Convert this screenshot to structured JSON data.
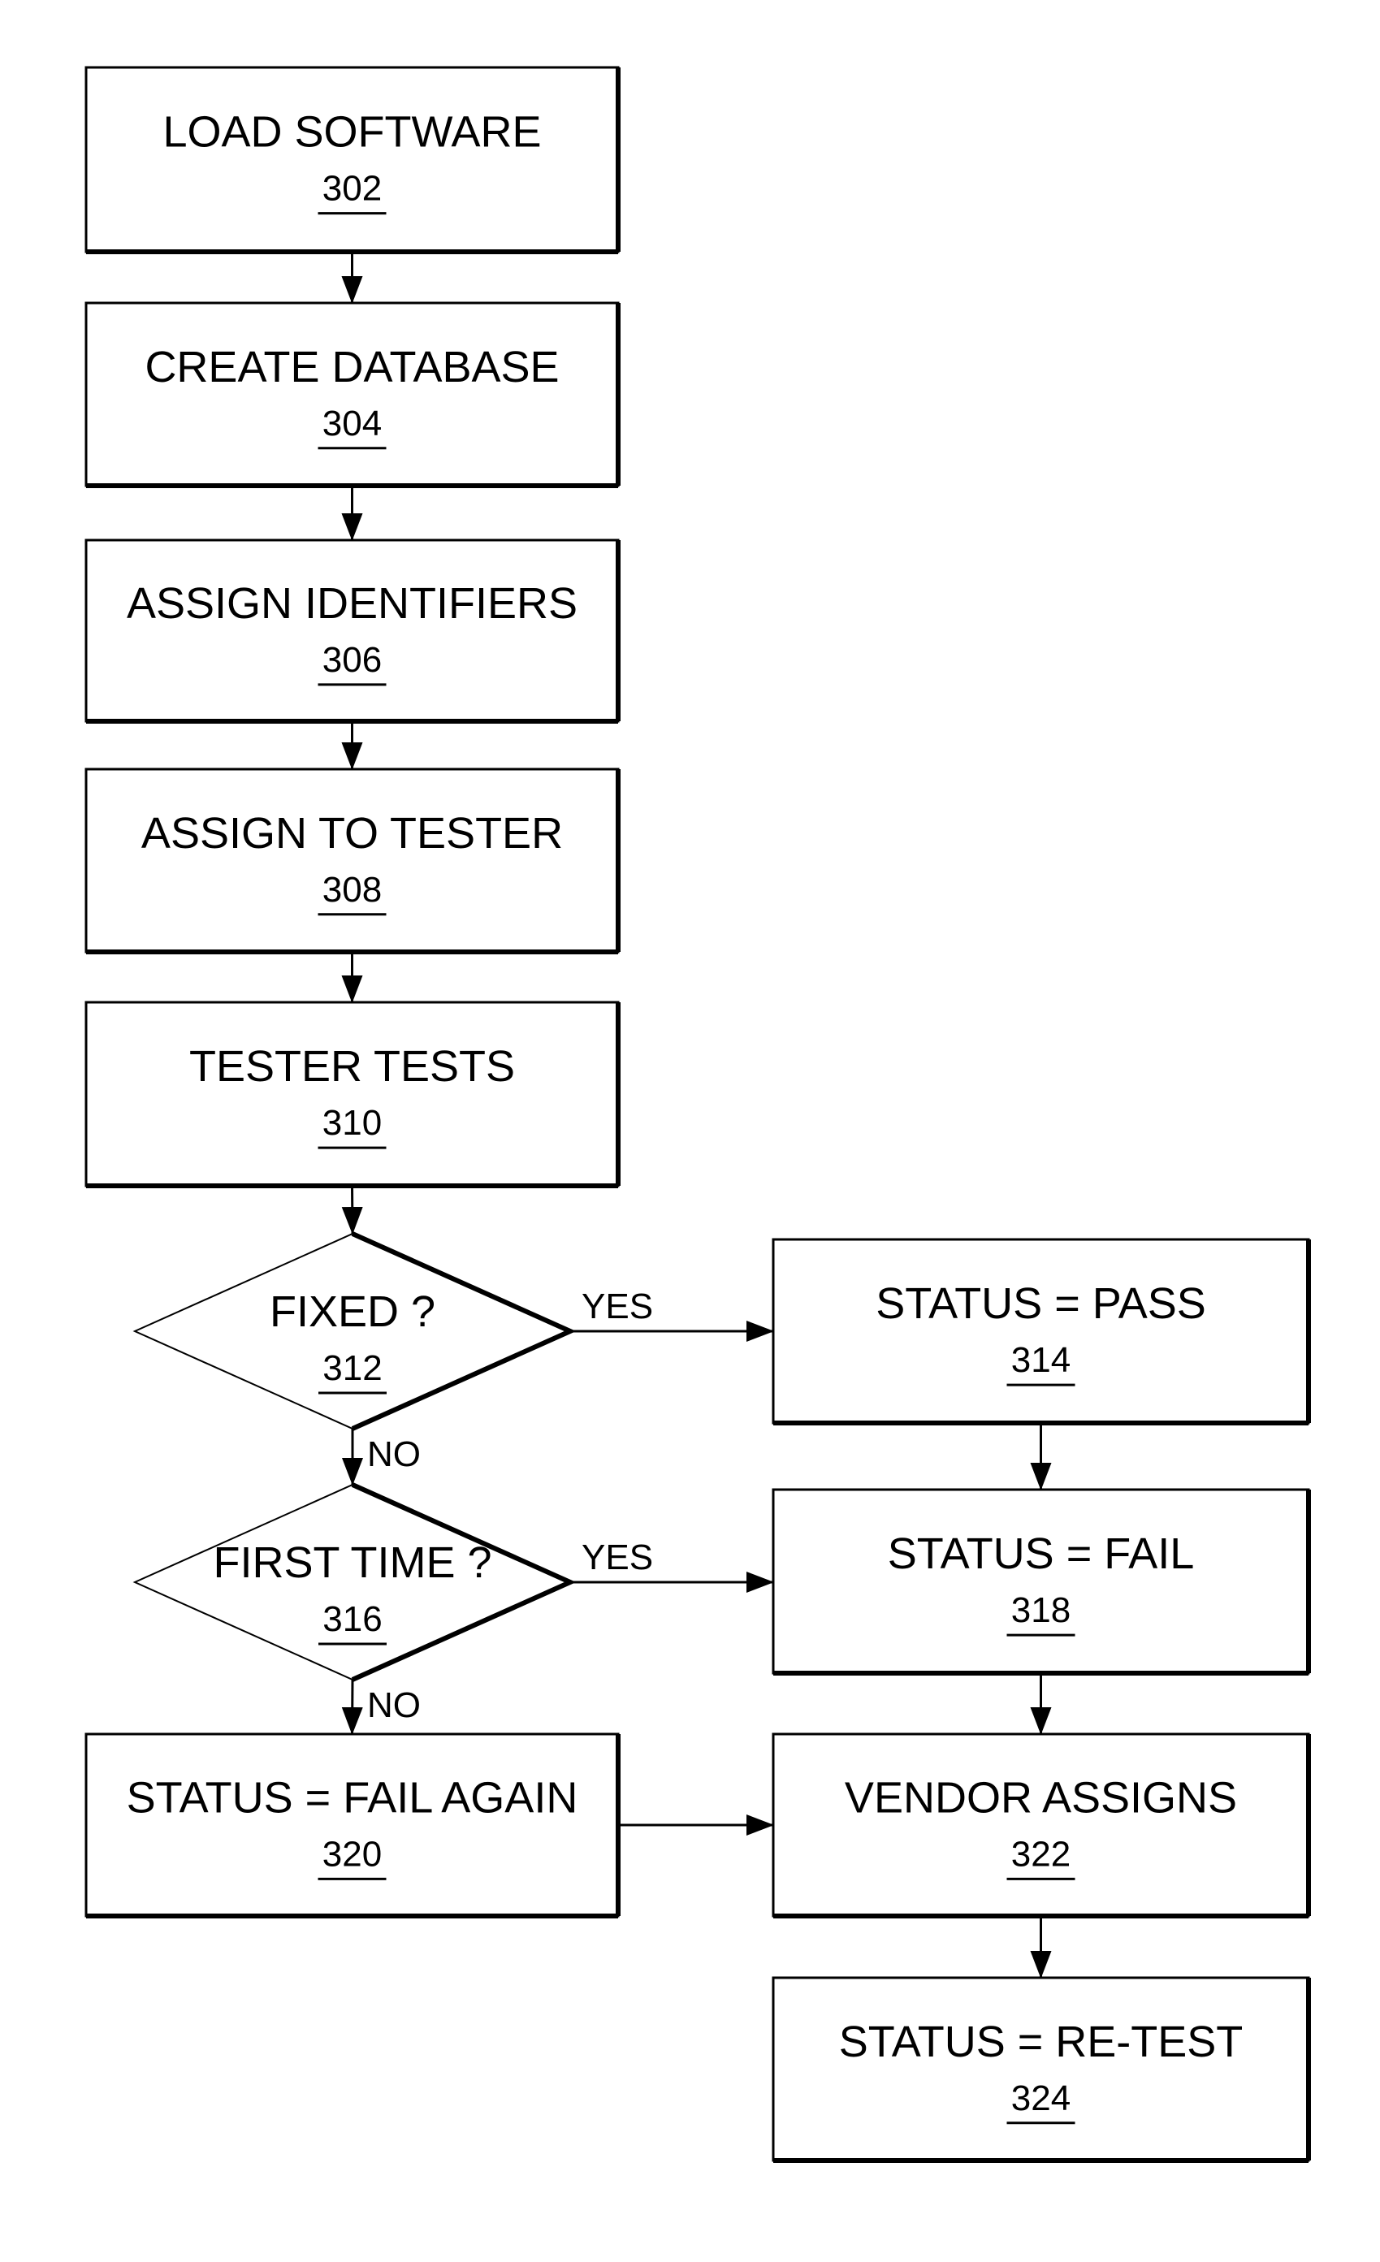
{
  "diagram": {
    "type": "flowchart",
    "nodes": [
      {
        "id": "302",
        "shape": "process",
        "label": "LOAD SOFTWARE",
        "ref": "302"
      },
      {
        "id": "304",
        "shape": "process",
        "label": "CREATE DATABASE",
        "ref": "304"
      },
      {
        "id": "306",
        "shape": "process",
        "label": "ASSIGN IDENTIFIERS",
        "ref": "306"
      },
      {
        "id": "308",
        "shape": "process",
        "label": "ASSIGN TO TESTER",
        "ref": "308"
      },
      {
        "id": "310",
        "shape": "process",
        "label": "TESTER TESTS",
        "ref": "310"
      },
      {
        "id": "312",
        "shape": "decision",
        "label": "FIXED ?",
        "ref": "312"
      },
      {
        "id": "314",
        "shape": "process",
        "label": "STATUS = PASS",
        "ref": "314"
      },
      {
        "id": "316",
        "shape": "decision",
        "label": "FIRST TIME ?",
        "ref": "316"
      },
      {
        "id": "318",
        "shape": "process",
        "label": "STATUS = FAIL",
        "ref": "318"
      },
      {
        "id": "320",
        "shape": "process",
        "label": "STATUS = FAIL AGAIN",
        "ref": "320"
      },
      {
        "id": "322",
        "shape": "process",
        "label": "VENDOR ASSIGNS",
        "ref": "322"
      },
      {
        "id": "324",
        "shape": "process",
        "label": "STATUS = RE-TEST",
        "ref": "324"
      }
    ],
    "edges": [
      {
        "from": "302",
        "to": "304",
        "label": ""
      },
      {
        "from": "304",
        "to": "306",
        "label": ""
      },
      {
        "from": "306",
        "to": "308",
        "label": ""
      },
      {
        "from": "308",
        "to": "310",
        "label": ""
      },
      {
        "from": "310",
        "to": "312",
        "label": ""
      },
      {
        "from": "312",
        "to": "314",
        "label": "YES"
      },
      {
        "from": "312",
        "to": "316",
        "label": "NO"
      },
      {
        "from": "314",
        "to": "318",
        "label": ""
      },
      {
        "from": "316",
        "to": "318",
        "label": "YES"
      },
      {
        "from": "316",
        "to": "320",
        "label": "NO"
      },
      {
        "from": "318",
        "to": "322",
        "label": ""
      },
      {
        "from": "320",
        "to": "322",
        "label": ""
      },
      {
        "from": "322",
        "to": "324",
        "label": ""
      }
    ]
  }
}
